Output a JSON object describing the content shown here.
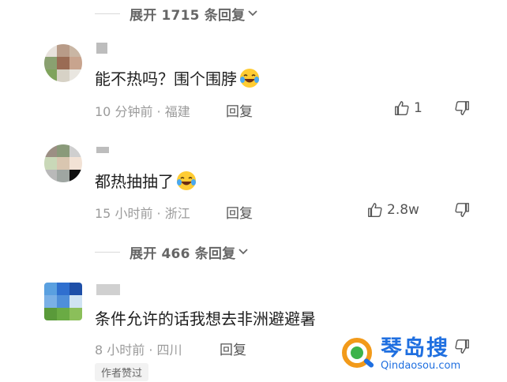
{
  "expand_top": {
    "label": "展开 1715 条回复"
  },
  "expand_mid": {
    "label": "展开 466 条回复"
  },
  "comments": [
    {
      "text": "能不热吗？围个围脖",
      "time": "10 分钟前 · 福建",
      "reply": "回复",
      "likes": "1"
    },
    {
      "text": "都热抽抽了",
      "time": "15 小时前 · 浙江",
      "reply": "回复",
      "likes": "2.8w"
    },
    {
      "text": "条件允许的话我想去非洲避避暑",
      "time": "8 小时前 · 四川",
      "reply": "回复",
      "badge": "作者赞过"
    }
  ],
  "watermark": {
    "title": "琴岛搜",
    "domain": "Qindaosou.com"
  },
  "icons": {
    "expand": "chevron-down-icon",
    "like": "thumbs-up-icon",
    "dislike": "thumbs-down-icon",
    "emoji": "laughing-tears-emoji-icon"
  },
  "colors": {
    "meta": "#9b9b9b",
    "text": "#1f1f1f",
    "watermark": "#1f6fe0"
  }
}
